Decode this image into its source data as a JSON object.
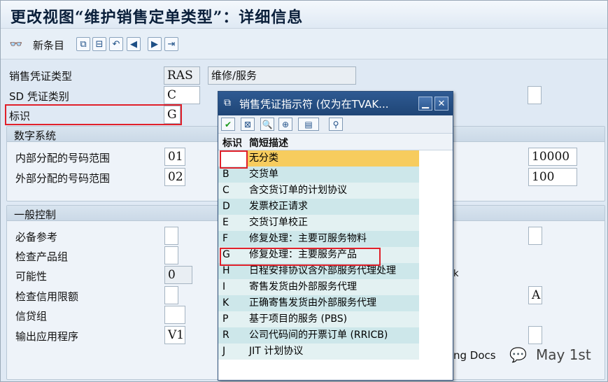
{
  "window": {
    "title": "更改视图“维护销售定单类型”：详细信息"
  },
  "toolbar": {
    "new_entries": "新条目"
  },
  "header_fields": [
    {
      "label": "销售凭证类型",
      "value": "RAS",
      "extra": "维修/服务"
    },
    {
      "label": "SD 凭证类别",
      "value": "C"
    },
    {
      "label": "标识",
      "value": "G"
    }
  ],
  "number_system": {
    "title": "数字系统",
    "rows": [
      {
        "label": "内部分配的号码范围",
        "value": "01",
        "right_value": "10000"
      },
      {
        "label": "外部分配的号码范围",
        "value": "02",
        "right_value": "100"
      }
    ]
  },
  "general_control": {
    "title": "一般控制",
    "rows": [
      {
        "label": "必备参考",
        "value": ""
      },
      {
        "label": "检查产品组",
        "value": ""
      },
      {
        "label": "可能性",
        "value": "0"
      },
      {
        "label": "检查信用限额",
        "value": ""
      },
      {
        "label": "信贷组",
        "value": ""
      },
      {
        "label": "输出应用程序",
        "value": "V1"
      }
    ],
    "right_values": [
      "",
      "A",
      ""
    ]
  },
  "partial_labels": {
    "ng_docs": "ng Docs",
    "k_char": "k"
  },
  "popup": {
    "title": "销售凭证指示符 (仅为在TVAK...",
    "col_key": "标识",
    "col_desc": "简短描述",
    "rows": [
      {
        "key": "",
        "desc": "无分类"
      },
      {
        "key": "B",
        "desc": "交货单"
      },
      {
        "key": "C",
        "desc": "含交货订单的计划协议"
      },
      {
        "key": "D",
        "desc": "发票校正请求"
      },
      {
        "key": "E",
        "desc": "交货订单校正"
      },
      {
        "key": "F",
        "desc": "修复处理：主要可服务物料"
      },
      {
        "key": "G",
        "desc": "修复处理：主要服务产品"
      },
      {
        "key": "H",
        "desc": "日程安排协议含外部服务代理处理"
      },
      {
        "key": "I",
        "desc": "寄售发货由外部服务代理"
      },
      {
        "key": "K",
        "desc": "正确寄售发货由外部服务代理"
      },
      {
        "key": "P",
        "desc": "基于项目的服务 (PBS)"
      },
      {
        "key": "R",
        "desc": "公司代码间的开票订单 (RRICB)"
      },
      {
        "key": "J",
        "desc": "JIT 计划协议"
      }
    ]
  },
  "watermark": {
    "text": "May 1st"
  }
}
